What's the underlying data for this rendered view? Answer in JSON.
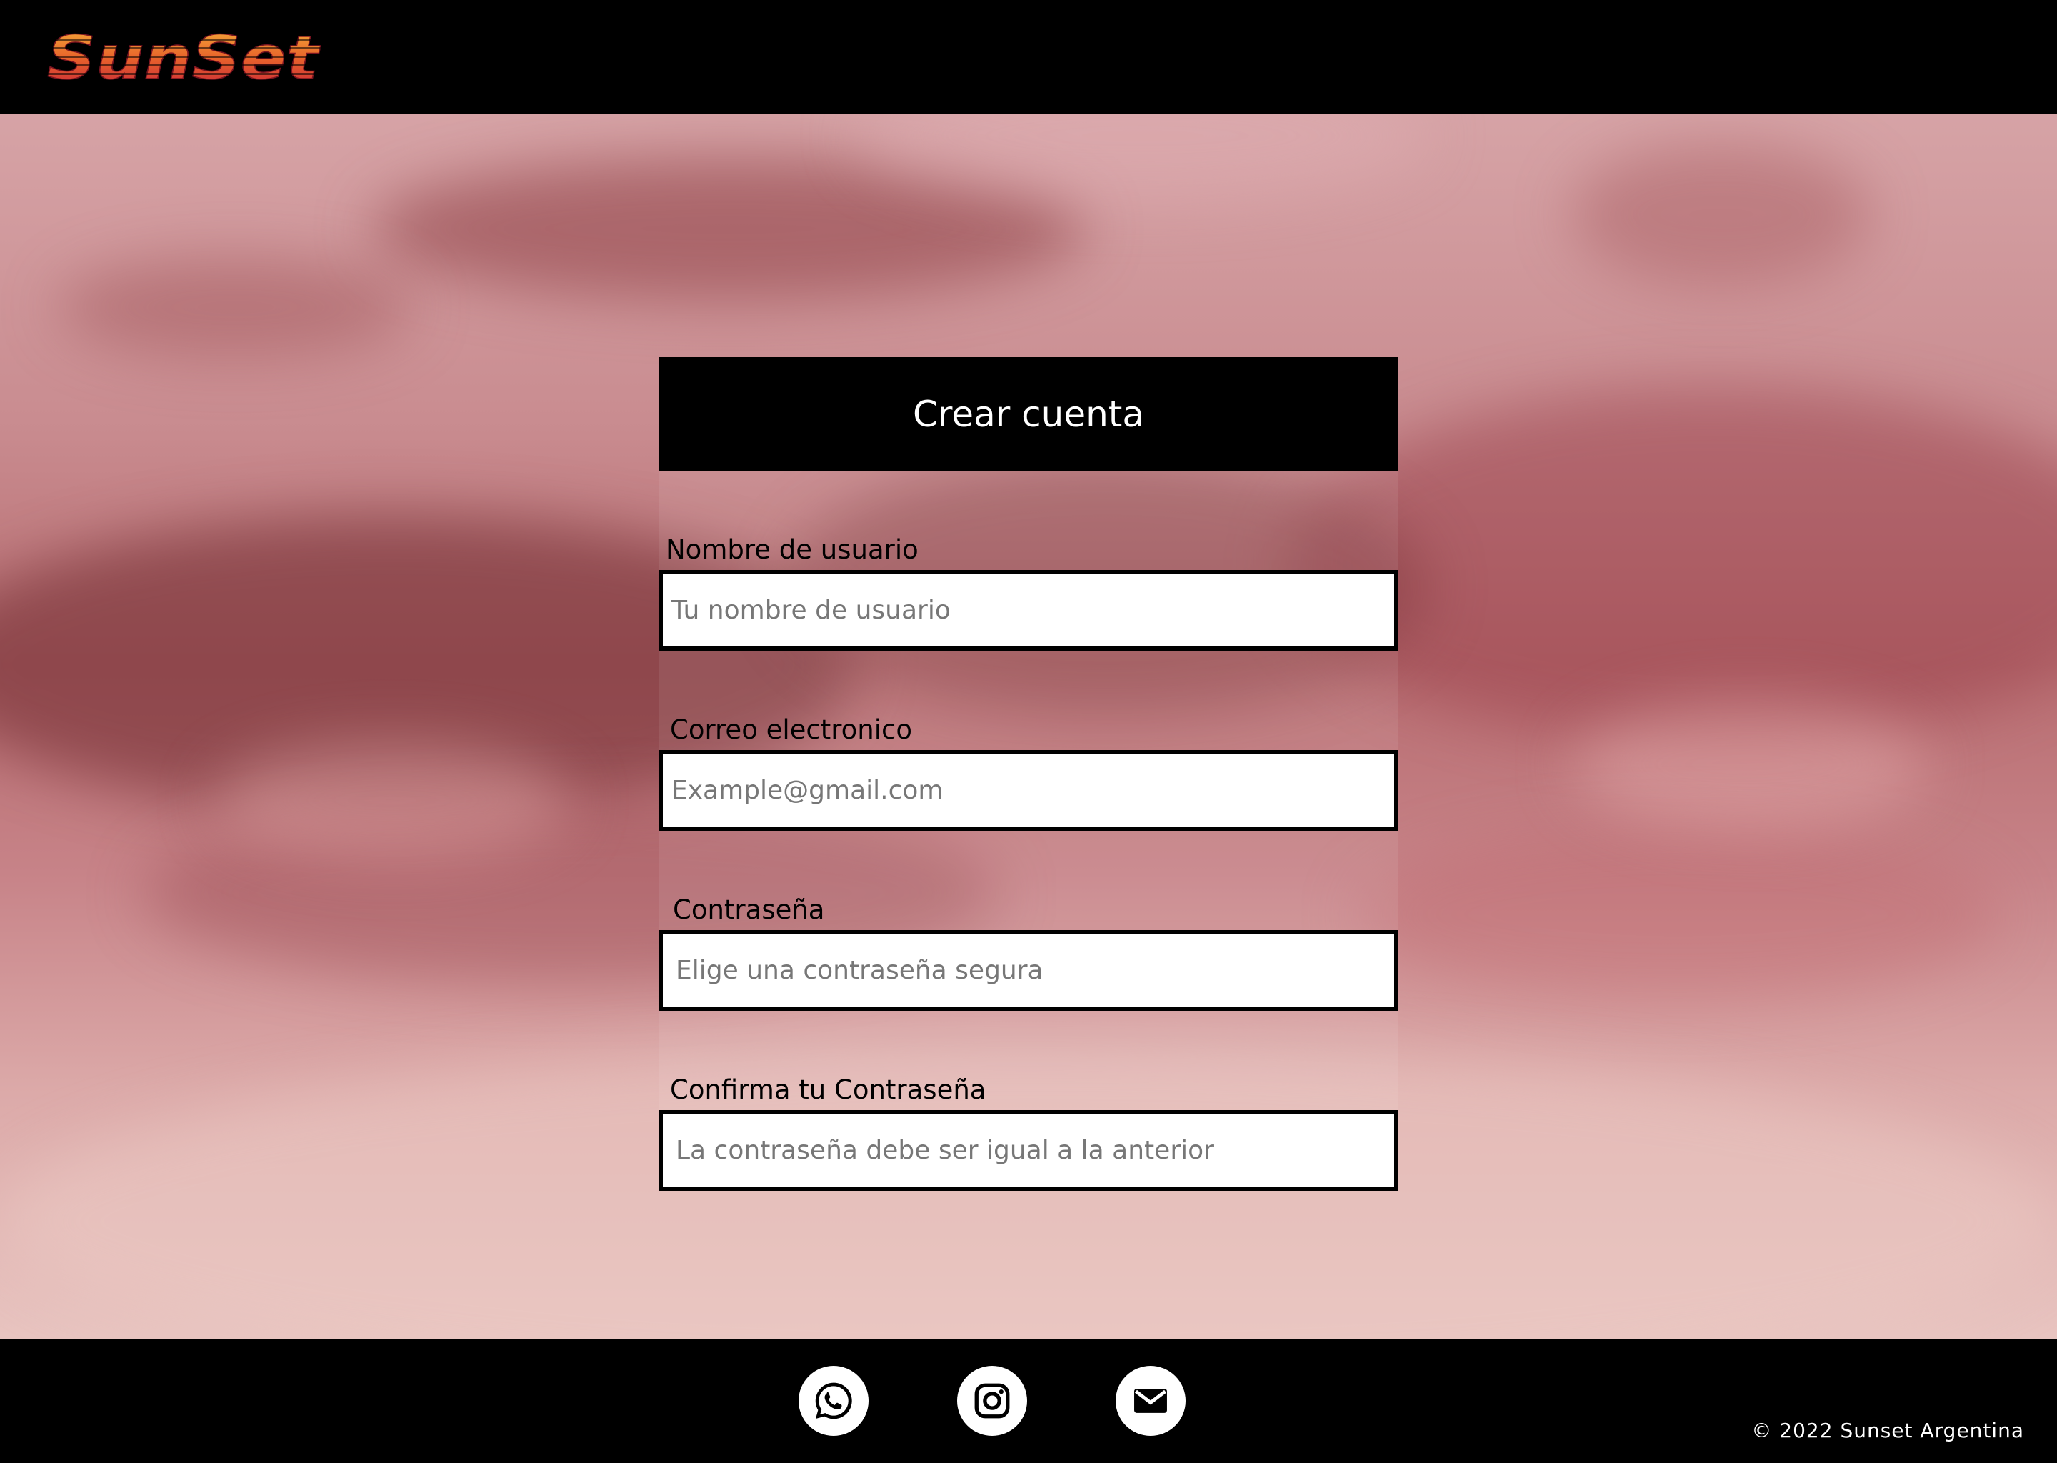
{
  "header": {
    "logo_text": "SunSet",
    "logo_gradient": [
      "#f5b53a",
      "#e8632b",
      "#c8233a"
    ]
  },
  "form": {
    "title": "Crear cuenta",
    "fields": [
      {
        "label": "Nombre de usuario",
        "placeholder": "Tu nombre de usuario"
      },
      {
        "label": "Correo electronico",
        "placeholder": "Example@gmail.com"
      },
      {
        "label": "Contraseña",
        "placeholder": "Elige una contraseña segura"
      },
      {
        "label": "Confirma tu Contraseña",
        "placeholder": "La contraseña debe ser igual a la anterior"
      }
    ]
  },
  "footer": {
    "social": [
      {
        "icon": "whatsapp-icon"
      },
      {
        "icon": "instagram-icon"
      },
      {
        "icon": "mail-icon"
      }
    ],
    "copyright": "© 2022 Sunset Argentina"
  }
}
